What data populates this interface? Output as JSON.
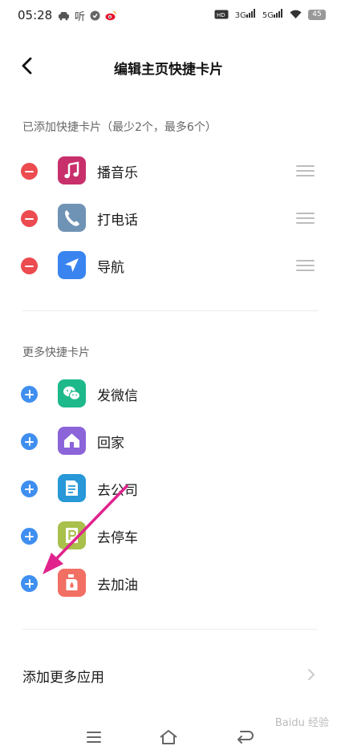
{
  "status_bar": {
    "time": "05:28",
    "listen_badge": "听",
    "network_1": "3G",
    "network_2": "5G",
    "battery": "45",
    "icons": [
      "car-icon",
      "weibo-icon",
      "hd-icon",
      "wifi-icon",
      "battery-icon"
    ]
  },
  "header": {
    "title": "编辑主页快捷卡片",
    "back_icon": "chevron-left-icon"
  },
  "added_section": {
    "label": "已添加快捷卡片（最少2个，最多6个）",
    "items": [
      {
        "label": "播音乐",
        "icon": "music-note-icon",
        "color": "#c8306b"
      },
      {
        "label": "打电话",
        "icon": "phone-icon",
        "color": "#6f93b4"
      },
      {
        "label": "导航",
        "icon": "navigation-icon",
        "color": "#3a84f0"
      }
    ]
  },
  "more_section": {
    "label": "更多快捷卡片",
    "items": [
      {
        "label": "发微信",
        "icon": "wechat-icon",
        "color": "#1eb98a"
      },
      {
        "label": "回家",
        "icon": "home-icon",
        "color": "#8b64d9"
      },
      {
        "label": "去公司",
        "icon": "document-icon",
        "color": "#2898d8"
      },
      {
        "label": "去停车",
        "icon": "parking-icon",
        "color": "#a9c04b"
      },
      {
        "label": "去加油",
        "icon": "fuel-icon",
        "color": "#f26f64"
      }
    ]
  },
  "more_apps": {
    "label": "添加更多应用"
  },
  "watermark": "Baidu 经验",
  "colors": {
    "remove": "#ec4b50",
    "add": "#3f8ff0",
    "annotation_arrow": "#e0238d"
  }
}
